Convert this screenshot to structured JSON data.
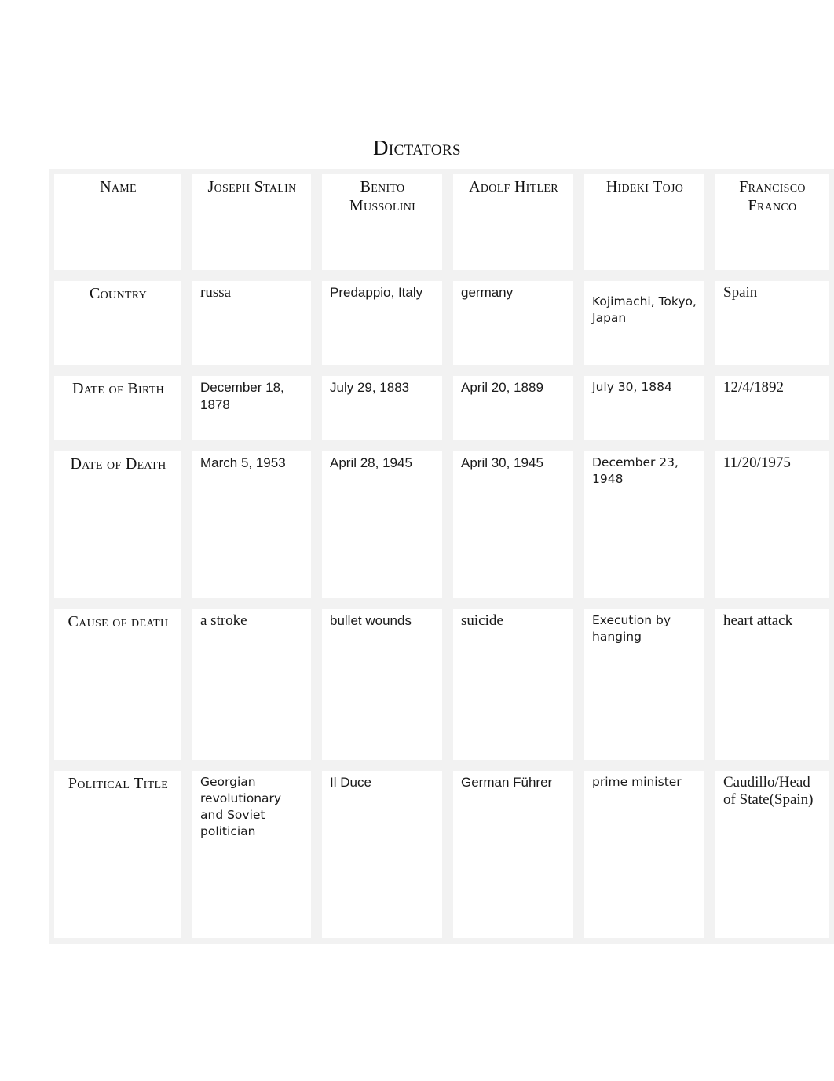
{
  "document": {
    "title": "Dictators"
  },
  "table": {
    "row_labels": [
      "Name",
      "Country",
      "Date of Birth",
      "Date of Death",
      "Cause of death",
      "Political Title"
    ],
    "columns": [
      "Joseph Stalin",
      "Benito Mussolini",
      "Adolf Hitler",
      "Hideki Tojo",
      "Francisco Franco"
    ],
    "rows": {
      "country": [
        "russa",
        "Predappio, Italy",
        "germany",
        "Kojimachi, Tokyo, Japan",
        "Spain"
      ],
      "date_of_birth": [
        "December 18, 1878",
        "July 29, 1883",
        "April 20, 1889",
        "July 30, 1884",
        "12/4/1892"
      ],
      "date_of_death": [
        "March 5, 1953",
        "April 28, 1945",
        "April 30, 1945",
        "December 23, 1948",
        "11/20/1975"
      ],
      "cause_of_death": [
        "a stroke",
        "bullet wounds",
        "suicide",
        "Execution by hanging",
        "heart attack"
      ],
      "political_title": [
        "Georgian revolutionary and Soviet politician",
        "Il Duce",
        "German Führer",
        "prime minister",
        "Caudillo/Head of State(Spain)"
      ]
    }
  },
  "colors": {
    "page_background": "#ffffff",
    "cell_background": "#ffffff",
    "grid_gutter": "#f2f2f2",
    "text": "#111111"
  }
}
